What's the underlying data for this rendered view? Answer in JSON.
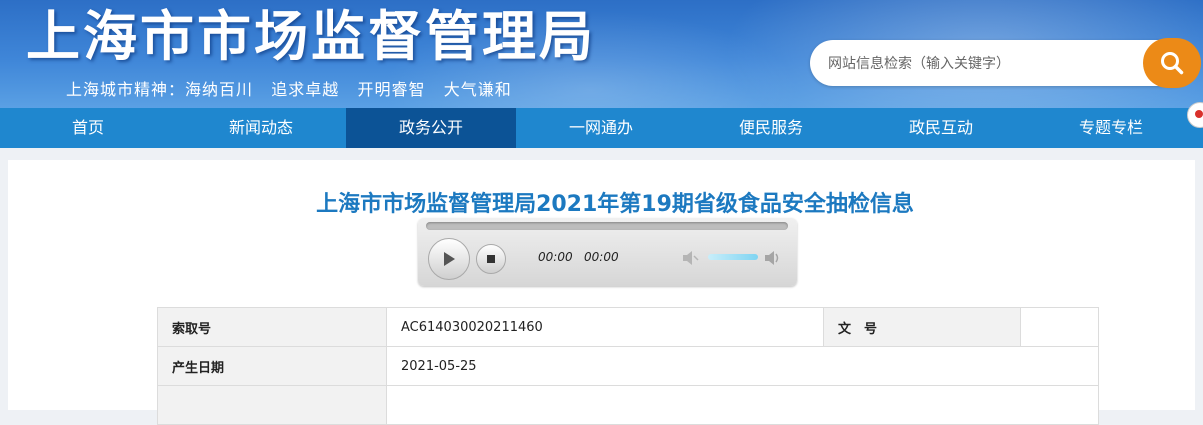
{
  "header": {
    "site_title": "上海市市场监督管理局",
    "slogan": "上海城市精神：海纳百川   追求卓越   开明睿智   大气谦和",
    "search_placeholder": "网站信息检索（输入关键字）"
  },
  "nav": {
    "items": [
      {
        "label": "首页"
      },
      {
        "label": "新闻动态"
      },
      {
        "label": "政务公开",
        "active": true
      },
      {
        "label": "一网通办"
      },
      {
        "label": "便民服务"
      },
      {
        "label": "政民互动"
      },
      {
        "label": "专题专栏"
      }
    ]
  },
  "article": {
    "title": "上海市市场监督管理局2021年第19期省级食品安全抽检信息"
  },
  "player": {
    "current_time": "00:00",
    "duration": "00:00",
    "volume": 0.8
  },
  "info": {
    "index_label": "索取号",
    "index_value": "AC614030020211460",
    "docno_label": "文　号",
    "docno_value": "",
    "date_label": "产生日期",
    "date_value": "2021-05-25"
  },
  "colors": {
    "nav_bg": "#1f87cf",
    "nav_active": "#0c5396",
    "title_blue": "#1c79c0",
    "search_orange": "#ec8a17"
  }
}
